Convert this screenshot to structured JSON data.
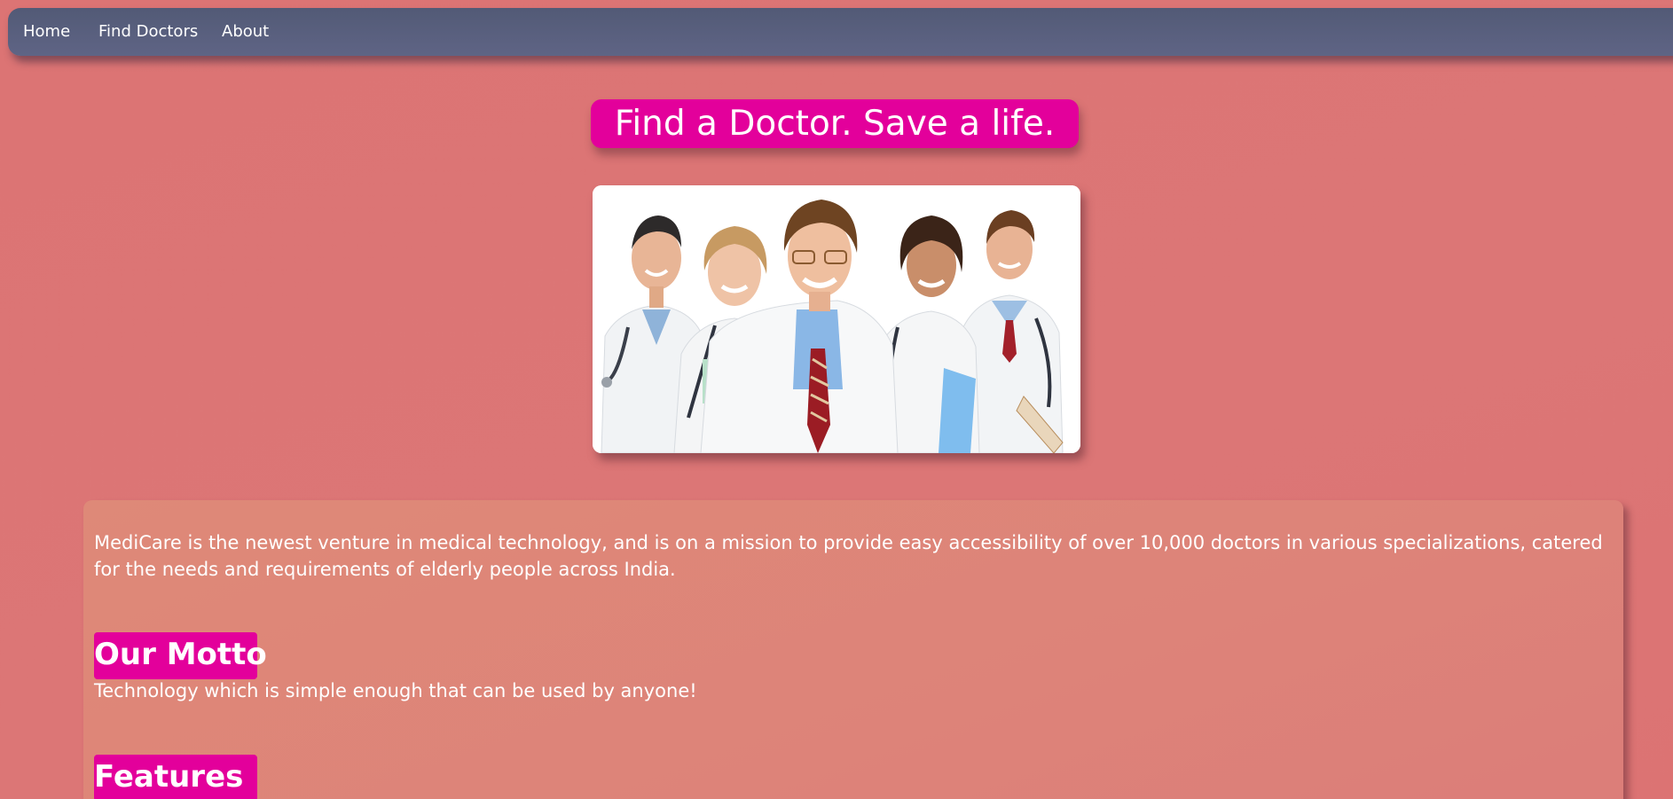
{
  "nav": {
    "items": [
      {
        "label": "Home"
      },
      {
        "label": "Find Doctors"
      },
      {
        "label": "About"
      }
    ]
  },
  "hero": {
    "title": "Find a Doctor. Save a life."
  },
  "content": {
    "intro": "MediCare is the newest venture in medical technology, and is on a mission to provide easy accessibility of over 10,000 doctors in various specializations, catered for the needs and requirements of elderly people across India.",
    "motto_heading": "Our Motto",
    "motto_text": "Technology which is simple enough that can be used by anyone!",
    "features_heading": "Features"
  },
  "colors": {
    "background": "#dc7474",
    "navbar": "#585e7c",
    "accent": "#e3009b",
    "card": "#dd8379"
  }
}
